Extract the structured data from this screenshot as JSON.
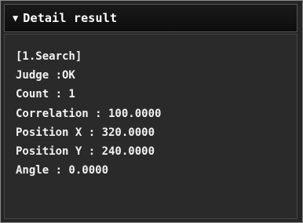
{
  "header": {
    "collapse_icon": "triangle-down-icon",
    "title": "Detail result"
  },
  "result": {
    "section": "[1.Search]",
    "judge": "Judge :OK",
    "count": "Count : 1",
    "correlation": "Correlation : 100.0000",
    "position_x": "Position X : 320.0000",
    "position_y": "Position Y : 240.0000",
    "angle": "Angle : 0.0000"
  },
  "colors": {
    "panel_bg": "#262626",
    "header_bg": "#0d0d0d",
    "text": "#f2f2f2"
  }
}
